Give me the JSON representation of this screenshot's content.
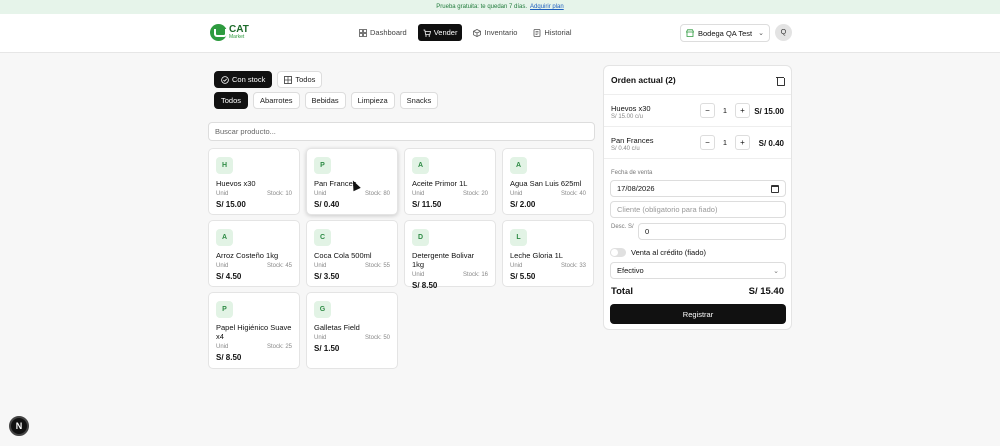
{
  "trial": {
    "text": "Prueba gratuita: te quedan 7 días.",
    "link": "Adquirir plan"
  },
  "brand": {
    "name": "CAT",
    "sub": "Market"
  },
  "nav": [
    {
      "label": "Dashboard",
      "icon": "dashboard-icon"
    },
    {
      "label": "Vender",
      "icon": "cart-icon",
      "active": true
    },
    {
      "label": "Inventario",
      "icon": "box-icon"
    },
    {
      "label": "Historial",
      "icon": "history-icon"
    }
  ],
  "store": {
    "label": "Bodega QA Test"
  },
  "user": {
    "initial": "Q"
  },
  "filters": {
    "stock": "Con stock",
    "all": "Todos"
  },
  "categories": [
    "Todos",
    "Abarrotes",
    "Bebidas",
    "Limpieza",
    "Snacks"
  ],
  "search": {
    "placeholder": "Buscar producto..."
  },
  "products": [
    {
      "badge": "H",
      "name": "Huevos x30",
      "unit": "Unid",
      "stock": "Stock: 10",
      "price": "S/ 15.00"
    },
    {
      "badge": "P",
      "name": "Pan Frances",
      "unit": "Unid",
      "stock": "Stock: 80",
      "price": "S/ 0.40"
    },
    {
      "badge": "A",
      "name": "Aceite Primor 1L",
      "unit": "Unid",
      "stock": "Stock: 20",
      "price": "S/ 11.50"
    },
    {
      "badge": "A",
      "name": "Agua San Luis 625ml",
      "unit": "Unid",
      "stock": "Stock: 40",
      "price": "S/ 2.00"
    },
    {
      "badge": "A",
      "name": "Arroz Costeño 1kg",
      "unit": "Unid",
      "stock": "Stock: 45",
      "price": "S/ 4.50"
    },
    {
      "badge": "C",
      "name": "Coca Cola 500ml",
      "unit": "Unid",
      "stock": "Stock: 55",
      "price": "S/ 3.50"
    },
    {
      "badge": "D",
      "name": "Detergente Bolivar 1kg",
      "unit": "Unid",
      "stock": "Stock: 16",
      "price": "S/ 8.50"
    },
    {
      "badge": "L",
      "name": "Leche Gloria 1L",
      "unit": "Unid",
      "stock": "Stock: 33",
      "price": "S/ 5.50"
    },
    {
      "badge": "P",
      "name": "Papel Higiénico Suave x4",
      "unit": "Unid",
      "stock": "Stock: 25",
      "price": "S/ 8.50"
    },
    {
      "badge": "G",
      "name": "Galletas Field",
      "unit": "Unid",
      "stock": "Stock: 50",
      "price": "S/ 1.50"
    }
  ],
  "order": {
    "title": "Orden actual (2)",
    "lines": [
      {
        "name": "Huevos x30",
        "unit_price": "S/ 15.00 c/u",
        "qty": "1",
        "total": "S/ 15.00"
      },
      {
        "name": "Pan Frances",
        "unit_price": "S/ 0.40 c/u",
        "qty": "1",
        "total": "S/ 0.40"
      }
    ],
    "minus": "−",
    "plus": "+",
    "date_label": "Fecha de venta",
    "date_value": "17/08/2026",
    "client_placeholder": "Cliente (obligatorio para fiado)",
    "discount_label": "Desc. S/",
    "discount_value": "0",
    "credit_label": "Venta al crédito (fiado)",
    "payment": "Efectivo",
    "total_label": "Total",
    "total_value": "S/ 15.40",
    "submit": "Registrar"
  },
  "fab": {
    "label": "N"
  }
}
